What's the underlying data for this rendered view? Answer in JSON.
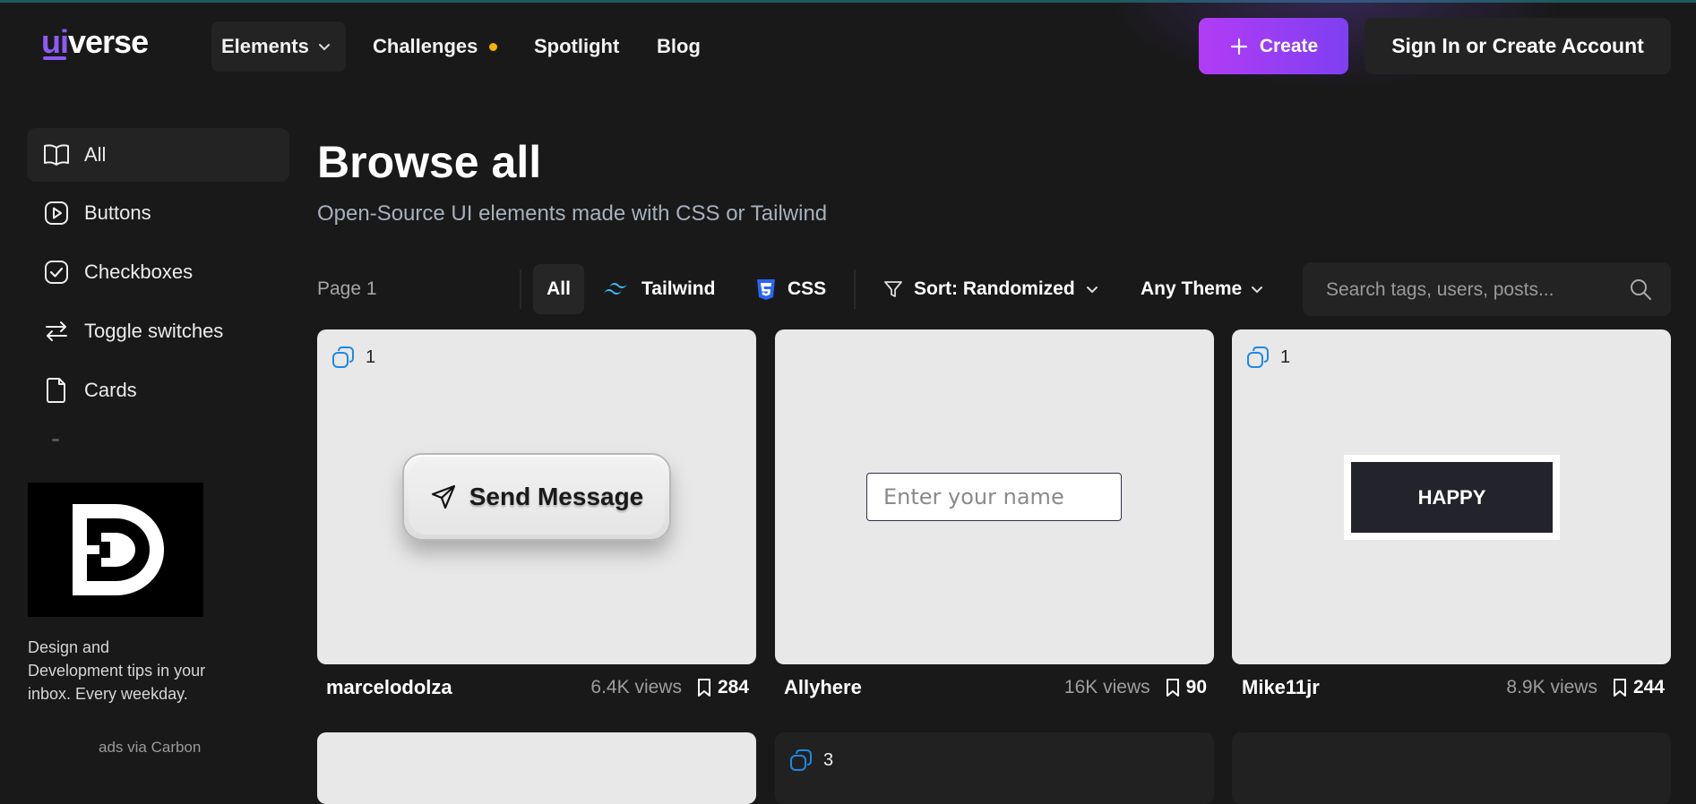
{
  "header": {
    "logo_ui": "ui",
    "logo_verse": "verse",
    "nav": {
      "elements": "Elements",
      "challenges": "Challenges",
      "spotlight": "Spotlight",
      "blog": "Blog"
    },
    "create_label": "Create",
    "signin_label": "Sign In or Create Account"
  },
  "sidebar": {
    "items": [
      {
        "label": "All",
        "icon": "book-open-icon",
        "active": true
      },
      {
        "label": "Buttons",
        "icon": "button-icon"
      },
      {
        "label": "Checkboxes",
        "icon": "checkbox-icon"
      },
      {
        "label": "Toggle switches",
        "icon": "toggle-arrows-icon"
      },
      {
        "label": "Cards",
        "icon": "card-icon"
      }
    ],
    "ad": {
      "text": "Design and Development tips in your inbox. Every weekday.",
      "via": "ads via Carbon"
    }
  },
  "main": {
    "title": "Browse all",
    "subtitle": "Open-Source UI elements made with CSS or Tailwind",
    "page_label": "Page 1",
    "filters": {
      "all": "All",
      "tailwind": "Tailwind",
      "css": "CSS",
      "sort": "Sort: Randomized",
      "theme": "Any Theme"
    },
    "search_placeholder": "Search tags, users, posts..."
  },
  "cards": [
    {
      "badge_count": "1",
      "preview_label": "Send Message",
      "author": "marcelodolza",
      "views": "6.4K views",
      "saves": "284"
    },
    {
      "preview_placeholder": "Enter your name",
      "author": "Allyhere",
      "views": "16K views",
      "saves": "90"
    },
    {
      "badge_count": "1",
      "preview_label": "HAPPY",
      "author": "Mike11jr",
      "views": "8.9K views",
      "saves": "244"
    }
  ],
  "cards_row2": [
    {},
    {
      "badge_count": "3"
    },
    {}
  ],
  "colors": {
    "background": "#191919",
    "accent_purple": "#8b5cf6",
    "create_gradient_start": "#b23cf5",
    "create_gradient_end": "#7f3ff1",
    "challenge_dot": "#f5b400",
    "tailwind_blue": "#38bdf8",
    "css_blue": "#2965f1"
  }
}
